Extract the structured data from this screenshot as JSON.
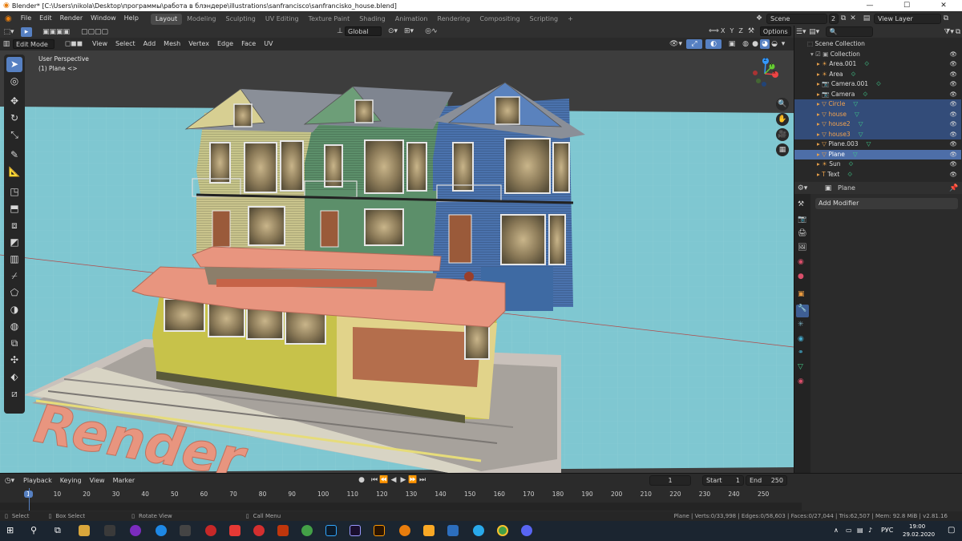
{
  "window": {
    "title": "Blender* [C:\\Users\\nikola\\Desktop\\программы\\работа в блэндере\\illustrations\\sanfrancisco\\sanfrancisko_house.blend]",
    "controls": [
      "—",
      "☐",
      "✕"
    ]
  },
  "menubar": {
    "menus": [
      "File",
      "Edit",
      "Render",
      "Window",
      "Help"
    ],
    "workspaces": [
      "Layout",
      "Modeling",
      "Sculpting",
      "UV Editing",
      "Texture Paint",
      "Shading",
      "Animation",
      "Rendering",
      "Compositing",
      "Scripting"
    ],
    "active_workspace": "Layout",
    "add_workspace": "+",
    "scene_label": "Scene",
    "scene_count": "2",
    "view_layer_label": "View Layer"
  },
  "viewport_header": {
    "mode": "Edit Mode",
    "menus": [
      "View",
      "Select",
      "Add",
      "Mesh",
      "Vertex",
      "Edge",
      "Face",
      "UV"
    ],
    "orientation": "Global",
    "axes": [
      "X",
      "Y",
      "Z"
    ],
    "options_label": "Options"
  },
  "viewport": {
    "perspective_label": "User Perspective",
    "object_label": "(1) Plane <>",
    "render_text": "Render",
    "gizmo_axes": [
      "X",
      "Y",
      "Z"
    ]
  },
  "toolbar": {
    "tools": [
      "select-box",
      "cursor",
      "move",
      "rotate",
      "scale",
      "annotate",
      "measure",
      "add-cube",
      "extrude",
      "inset",
      "bevel",
      "loop-cut",
      "knife",
      "poly-build",
      "spin",
      "smooth",
      "edge-slide",
      "shrink-fatten",
      "shear",
      "rip"
    ]
  },
  "outliner": {
    "search_placeholder": "",
    "root": "Scene Collection",
    "collection": "Collection",
    "items": [
      {
        "name": "Area.001",
        "icon": "light-icon",
        "state": "normal"
      },
      {
        "name": "Area",
        "icon": "light-icon",
        "state": "normal"
      },
      {
        "name": "Camera.001",
        "icon": "camera-icon",
        "state": "normal"
      },
      {
        "name": "Camera",
        "icon": "camera-icon",
        "state": "normal"
      },
      {
        "name": "Circle",
        "icon": "mesh-icon",
        "state": "selected"
      },
      {
        "name": "house",
        "icon": "mesh-icon",
        "state": "selected"
      },
      {
        "name": "house2",
        "icon": "mesh-icon",
        "state": "selected"
      },
      {
        "name": "house3",
        "icon": "mesh-icon",
        "state": "selected"
      },
      {
        "name": "Plane.003",
        "icon": "mesh-icon",
        "state": "normal"
      },
      {
        "name": "Plane",
        "icon": "mesh-icon",
        "state": "active"
      },
      {
        "name": "Sun",
        "icon": "light-icon",
        "state": "normal"
      },
      {
        "name": "Text",
        "icon": "text-icon",
        "state": "normal"
      }
    ]
  },
  "properties": {
    "object_name": "Plane",
    "add_modifier_label": "Add Modifier"
  },
  "timeline": {
    "menus": [
      "Playback",
      "Keying",
      "View",
      "Marker"
    ],
    "current_frame": "1",
    "start_label": "Start",
    "start_value": "1",
    "end_label": "End",
    "end_value": "250",
    "ticks": [
      "1",
      "10",
      "20",
      "30",
      "40",
      "50",
      "60",
      "70",
      "80",
      "90",
      "100",
      "110",
      "120",
      "130",
      "140",
      "150",
      "160",
      "170",
      "180",
      "190",
      "200",
      "210",
      "220",
      "230",
      "240",
      "250"
    ]
  },
  "statusbar": {
    "select": "Select",
    "box_select": "Box Select",
    "rotate_view": "Rotate View",
    "call_menu": "Call Menu",
    "stats": "Plane | Verts:0/33,998 | Edges:0/58,603 | Faces:0/27,044 | Tris:62,507 | Mem: 92.8 MiB | v2.81.16"
  },
  "taskbar": {
    "language": "РУС",
    "time": "19:00",
    "date": "29.02.2020"
  },
  "colors": {
    "accent_blue": "#5680c2",
    "selected_row": "#334c79",
    "active_row": "#4d6ea8",
    "floor": "#7fc7d1",
    "tram_roof": "#e8957f",
    "tram_body": "#c7c24a"
  }
}
